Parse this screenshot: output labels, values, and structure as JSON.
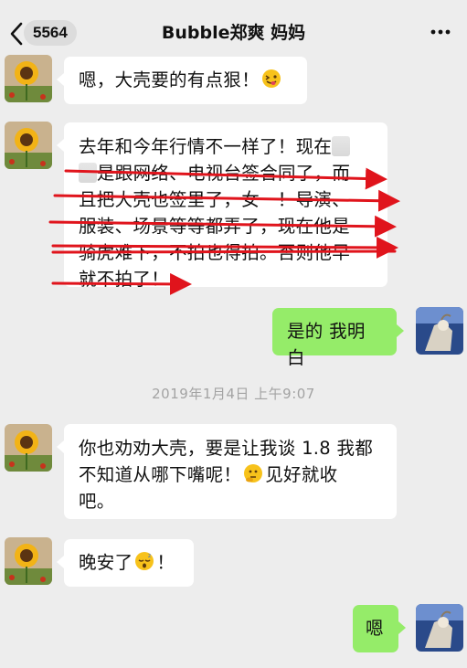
{
  "header": {
    "unread_count": "5564",
    "title": "Bubble郑爽 妈妈"
  },
  "messages": [
    {
      "side": "left",
      "pre": "嗯，大壳要的有点狠！",
      "emoji": "squinting-tongue-emoji",
      "post": ""
    },
    {
      "side": "left",
      "l1": "去年和今年行情不一样了！现在",
      "l2": "是跟网络、电视台签合同了，而",
      "l3": "且把大壳也签里了，女一！导演、",
      "l4": "服装、场景等等都弄了，现在他是",
      "l5": "骑虎难下，不拍也得拍。否则他早",
      "l6": "就不拍了！"
    },
    {
      "side": "right",
      "text": "是的 我明白"
    },
    {
      "side": "left",
      "l1": "你也劝劝大壳，要是让我谈 1.8 我都",
      "l2": "不知道从哪下嘴呢！",
      "emoji": "thinking-emoji",
      "l2b": "见好就收",
      "l3": "吧。"
    },
    {
      "side": "left",
      "pre": "晚安了",
      "emoji": "sleepy-emoji",
      "post": "！"
    },
    {
      "side": "right",
      "text": "嗯"
    }
  ],
  "timestamp": "2019年1月4日 上午9:07",
  "colors": {
    "left_bubble": "#ffffff",
    "right_bubble": "#95ec69",
    "background": "#ededed",
    "annotation_red": "#e0141c"
  },
  "annotations": {
    "type": "red-underline-arrows",
    "count": 6
  }
}
